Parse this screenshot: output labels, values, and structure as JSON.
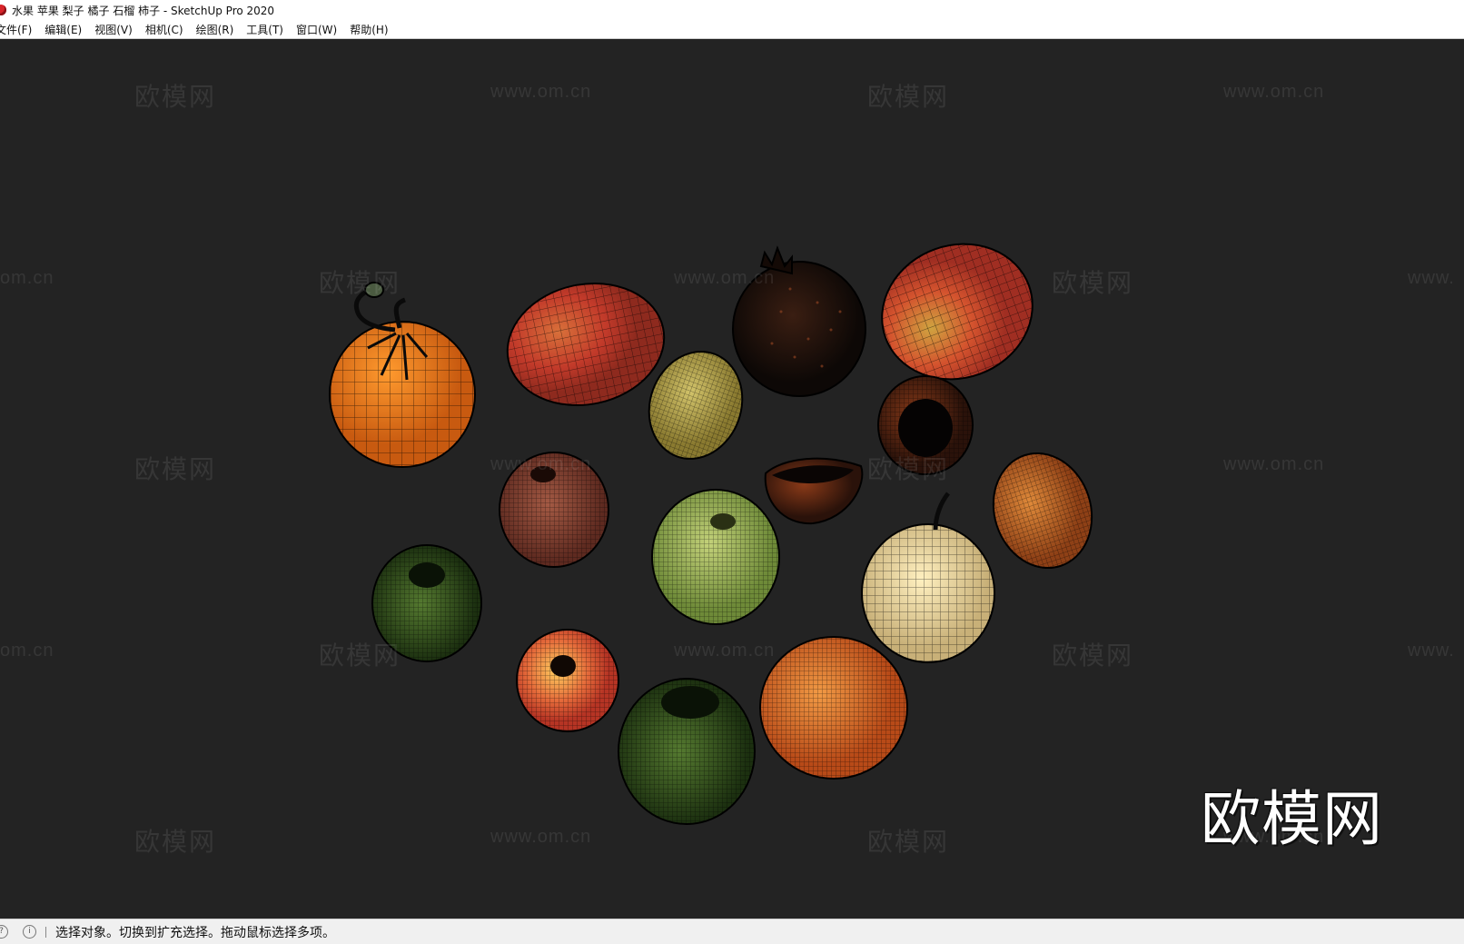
{
  "window": {
    "title": "水果 苹果 梨子 橘子 石榴 柿子 - SketchUp Pro 2020"
  },
  "menu": {
    "items": [
      "文件(F)",
      "编辑(E)",
      "视图(V)",
      "相机(C)",
      "绘图(R)",
      "工具(T)",
      "窗口(W)",
      "帮助(H)"
    ]
  },
  "watermark": {
    "brand": "欧模网",
    "url": "www.om.cn",
    "partial_url_left": "om.cn",
    "partial_url_right": "www."
  },
  "status": {
    "message": "选择对象。切换到扩充选择。拖动鼠标选择多项。",
    "icon_1": "?",
    "icon_2": "i"
  },
  "colors": {
    "viewport_bg": "#232323",
    "orange": "#e8761c",
    "mango_red": "#c9442e",
    "lemon": "#b0a048",
    "pear": "#f1deaa",
    "green_apple": "#a7c25e",
    "dark_green_apple": "#3e6324"
  }
}
